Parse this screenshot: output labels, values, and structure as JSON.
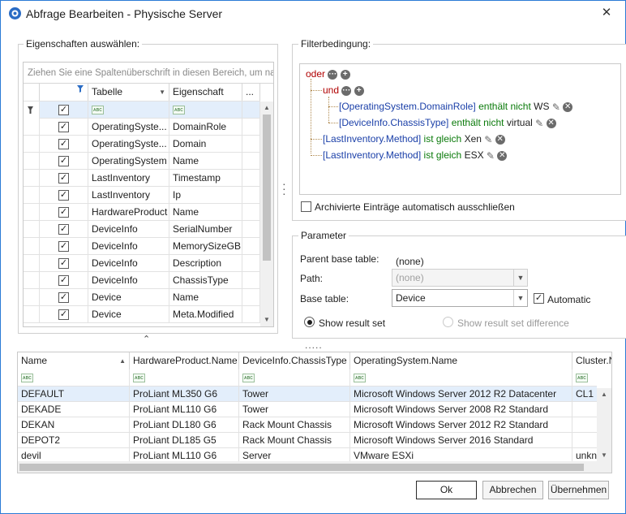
{
  "window": {
    "title": "Abfrage Bearbeiten - Physische Server",
    "close_glyph": "✕"
  },
  "properties": {
    "group_title": "Eigenschaften auswählen:",
    "groupby_hint": "Ziehen Sie eine Spaltenüberschrift in diesen Bereich, um nach d",
    "columns": {
      "table": "Tabelle",
      "property": "Eigenschaft",
      "more": "..."
    },
    "filter_row": {
      "table": "ᴀʙc",
      "property": "ᴀʙc"
    },
    "rows": [
      {
        "table": "OperatingSyste...",
        "property": "DomainRole"
      },
      {
        "table": "OperatingSyste...",
        "property": "Domain"
      },
      {
        "table": "OperatingSystem",
        "property": "Name"
      },
      {
        "table": "LastInventory",
        "property": "Timestamp"
      },
      {
        "table": "LastInventory",
        "property": "Ip"
      },
      {
        "table": "HardwareProduct",
        "property": "Name"
      },
      {
        "table": "DeviceInfo",
        "property": "SerialNumber"
      },
      {
        "table": "DeviceInfo",
        "property": "MemorySizeGB"
      },
      {
        "table": "DeviceInfo",
        "property": "Description"
      },
      {
        "table": "DeviceInfo",
        "property": "ChassisType"
      },
      {
        "table": "Device",
        "property": "Name"
      },
      {
        "table": "Device",
        "property": "Meta.Modified"
      }
    ]
  },
  "filter": {
    "group_title": "Filterbedingung:",
    "or_label": "oder",
    "and_label": "und",
    "cond1": {
      "field": "[OperatingSystem.DomainRole]",
      "op": "enthält nicht",
      "value": "WS"
    },
    "cond2": {
      "field": "[DeviceInfo.ChassisType]",
      "op": "enthält nicht",
      "value": "virtual"
    },
    "cond3": {
      "field": "[LastInventory.Method]",
      "op": "ist gleich",
      "value": "Xen"
    },
    "cond4": {
      "field": "[LastInventory.Method]",
      "op": "ist gleich",
      "value": "ESX"
    },
    "archive_label": "Archivierte Einträge automatisch ausschließen"
  },
  "parameter": {
    "group_title": "Parameter",
    "parent_label": "Parent base table:",
    "parent_value": "(none)",
    "path_label": "Path:",
    "path_value": "(none)",
    "base_label": "Base table:",
    "base_value": "Device",
    "automatic_label": "Automatic",
    "show_result": "Show result set",
    "show_diff": "Show result set difference"
  },
  "results": {
    "columns": [
      "Name",
      "HardwareProduct.Name",
      "DeviceInfo.ChassisType",
      "OperatingSystem.Name",
      "Cluster.N"
    ],
    "rows": [
      [
        "DEFAULT",
        "ProLiant ML350 G6",
        "Tower",
        "Microsoft Windows Server 2012 R2 Datacenter",
        "CL1"
      ],
      [
        "DEKADE",
        "ProLiant ML110 G6",
        "Tower",
        "Microsoft Windows Server 2008 R2 Standard",
        ""
      ],
      [
        "DEKAN",
        "ProLiant DL180 G6",
        "Rack Mount Chassis",
        "Microsoft Windows Server 2012 R2 Standard",
        ""
      ],
      [
        "DEPOT2",
        "ProLiant DL185 G5",
        "Rack Mount Chassis",
        "Microsoft Windows Server 2016 Standard",
        ""
      ],
      [
        "devil",
        "ProLiant ML110 G6",
        "Server",
        "VMware ESXi",
        "unkno"
      ]
    ]
  },
  "buttons": {
    "ok": "Ok",
    "cancel": "Abbrechen",
    "apply": "Übernehmen"
  },
  "icons": {
    "filter_pin": "filter-pin-icon",
    "splitter": "splitter-grip-icon",
    "collapse": "chevron-up-icon"
  }
}
